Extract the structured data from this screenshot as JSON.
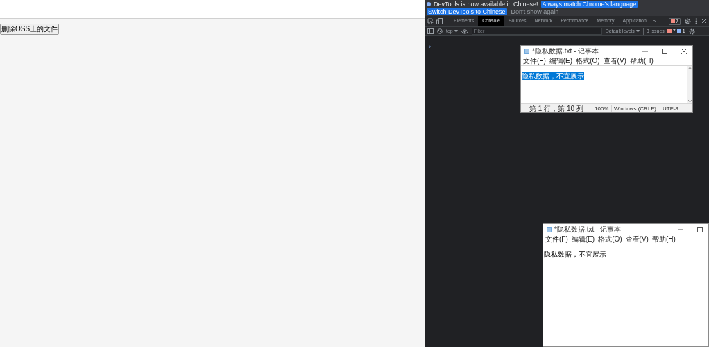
{
  "page": {
    "button": "删除OSS上的文件"
  },
  "devtools": {
    "banner": {
      "message": "DevTools is now available in Chinese!",
      "buttons": [
        "Always match Chrome's language",
        "Switch DevTools to Chinese"
      ],
      "dismiss": "Don't show again"
    },
    "tabs": [
      {
        "label": "Elements",
        "selected": false
      },
      {
        "label": "Console",
        "selected": true
      },
      {
        "label": "Sources",
        "selected": false
      },
      {
        "label": "Network",
        "selected": false
      },
      {
        "label": "Performance",
        "selected": false
      },
      {
        "label": "Memory",
        "selected": false
      },
      {
        "label": "Application",
        "selected": false
      }
    ],
    "overflow": "»",
    "error_count": "7",
    "toolbar": {
      "context": "top",
      "filter_placeholder": "Filter",
      "levels": "Default levels",
      "issues_label": "8 Issues:",
      "issue_errors": "7",
      "issue_info": "1"
    },
    "prompt": "›"
  },
  "notepads": [
    {
      "title": "*隐私数据.txt - 记事本",
      "menus": [
        "文件(F)",
        "编辑(E)",
        "格式(O)",
        "查看(V)",
        "帮助(H)"
      ],
      "text": "隐私数据，不宜展示",
      "text_selected": true,
      "status": [
        "第 1 行，第 10 列",
        "100%",
        "Windows (CRLF)",
        "UTF-8"
      ]
    },
    {
      "title": "*隐私数据.txt - 记事本",
      "menus": [
        "文件(F)",
        "编辑(E)",
        "格式(O)",
        "查看(V)",
        "帮助(H)"
      ],
      "text": "隐私数据，不宜展示",
      "text_selected": false
    }
  ]
}
